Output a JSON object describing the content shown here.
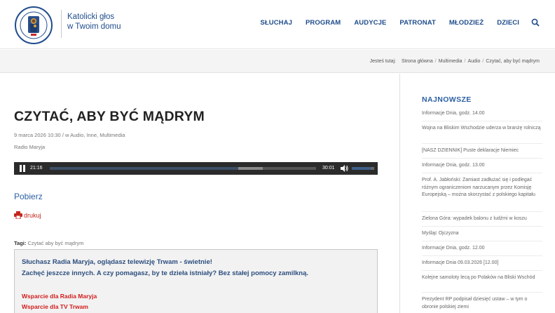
{
  "header": {
    "tagline_line1": "Katolicki głos",
    "tagline_line2": "w Twoim domu",
    "logo_text": "RADIO MARYJA",
    "nav": [
      "SŁUCHAJ",
      "PROGRAM",
      "AUDYCJE",
      "PATRONAT",
      "MŁODZIEŻ",
      "DZIECI"
    ],
    "search_icon": "search-icon"
  },
  "breadcrumb": {
    "prefix": "Jesteś tutaj:",
    "items": [
      "Strona główna",
      "Multimedia",
      "Audio",
      "Czytać, aby być mądrym"
    ]
  },
  "article": {
    "title": "CZYTAĆ, ABY BYĆ MĄDRYM",
    "date": "9 marca 2026 10:30",
    "in_label": "w",
    "categories": "Audio, Inne, Multimedia",
    "author": "Radio Maryja",
    "player": {
      "current_time": "21:16",
      "duration": "30:01",
      "progress_fraction": 0.709,
      "buffered_fraction": 0.8,
      "volume_fraction": 0.85
    },
    "download_label": "Pobierz",
    "print_label": "drukuj",
    "tags_label": "Tagi:",
    "tags_value": "Czytać aby być mądrym",
    "support": {
      "line1": "Słuchasz Radia Maryja, oglądasz telewizję Trwam - świetnie!",
      "line2": "Zachęć jeszcze innych. A czy pomagasz, by te dzieła istniały? Bez stałej pomocy zamilkną.",
      "link1": "Wsparcie dla Radia Maryja",
      "link2": "Wsparcie dla TV Trwam"
    }
  },
  "sidebar": {
    "title": "NAJNOWSZE",
    "items": [
      "Informacje Dnia, godz. 14.00",
      "Wojna na Bliskim Wschodzie uderza w branżę rolniczą",
      "[NASZ DZIENNIK] Puste deklaracje Niemiec",
      "Informacje Dnia, godz. 13.00",
      "Prof. A. Jabłoński: Zamiast zadłużać się i podlegać różnym ograniczeniom narzucanym przez Komisję Europejską – można skorzystać z polskiego kapitału",
      "Zielona Góra: wypadek balonu z ludźmi w koszu",
      "Myśląc Ojczyzna",
      "Informacje Dnia, godz. 12.00",
      "Informacje Dnia 09.03.2026 [12.00]",
      "Kolejne samoloty lecą po Polaków na Bliski Wschód",
      "Prezydent RP podpisał dziesięć ustaw – w tym o obronie polskiej ziemi"
    ]
  },
  "colors": {
    "brand_blue": "#1f4c8c",
    "link_blue": "#2b5fa3",
    "accent_red": "#d21c1c",
    "player_bg": "#2b2b2b"
  }
}
